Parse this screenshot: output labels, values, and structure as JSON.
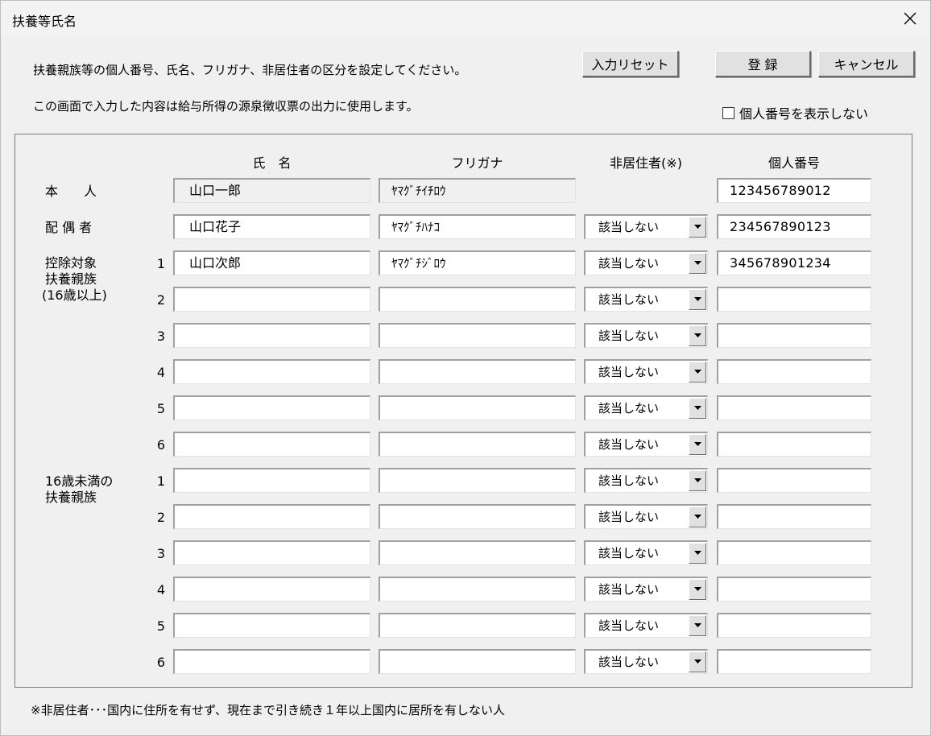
{
  "window": {
    "title": "扶養等氏名",
    "close_glyph": "✕"
  },
  "description": {
    "line1": "扶養親族等の個人番号、氏名、フリガナ、非居住者の区分を設定してください。",
    "line2": "この画面で入力した内容は給与所得の源泉徴収票の出力に使用します。"
  },
  "buttons": {
    "reset": "入力リセット",
    "register": "登 録",
    "cancel": "キャンセル"
  },
  "hide_id_checkbox": {
    "label": "個人番号を表示しない",
    "checked": false
  },
  "headers": {
    "name": "氏　名",
    "furigana": "フリガナ",
    "nonresident": "非居住者(※)",
    "id_number": "個人番号"
  },
  "rows": {
    "self": {
      "label": "本　　人",
      "name": "山口一郎",
      "furigana": "ﾔﾏｸﾞﾁｲﾁﾛｳ",
      "id_number": "123456789012"
    },
    "spouse": {
      "label": "配 偶 者",
      "name": "山口花子",
      "furigana": "ﾔﾏｸﾞﾁﾊﾅｺ",
      "nonresident": "該当しない",
      "id_number": "234567890123"
    }
  },
  "groups": {
    "over16": {
      "label_lines": [
        "控除対象",
        "扶養親族",
        "(16歳以上)"
      ],
      "rows": [
        {
          "no": "1",
          "name": "山口次郎",
          "furigana": "ﾔﾏｸﾞﾁｼﾞﾛｳ",
          "nonresident": "該当しない",
          "id_number": "345678901234"
        },
        {
          "no": "2",
          "name": "",
          "furigana": "",
          "nonresident": "該当しない",
          "id_number": ""
        },
        {
          "no": "3",
          "name": "",
          "furigana": "",
          "nonresident": "該当しない",
          "id_number": ""
        },
        {
          "no": "4",
          "name": "",
          "furigana": "",
          "nonresident": "該当しない",
          "id_number": ""
        },
        {
          "no": "5",
          "name": "",
          "furigana": "",
          "nonresident": "該当しない",
          "id_number": ""
        },
        {
          "no": "6",
          "name": "",
          "furigana": "",
          "nonresident": "該当しない",
          "id_number": ""
        }
      ]
    },
    "under16": {
      "label_lines": [
        "16歳未満の",
        "扶養親族"
      ],
      "rows": [
        {
          "no": "1",
          "name": "",
          "furigana": "",
          "nonresident": "該当しない",
          "id_number": ""
        },
        {
          "no": "2",
          "name": "",
          "furigana": "",
          "nonresident": "該当しない",
          "id_number": ""
        },
        {
          "no": "3",
          "name": "",
          "furigana": "",
          "nonresident": "該当しない",
          "id_number": ""
        },
        {
          "no": "4",
          "name": "",
          "furigana": "",
          "nonresident": "該当しない",
          "id_number": ""
        },
        {
          "no": "5",
          "name": "",
          "furigana": "",
          "nonresident": "該当しない",
          "id_number": ""
        },
        {
          "no": "6",
          "name": "",
          "furigana": "",
          "nonresident": "該当しない",
          "id_number": ""
        }
      ]
    }
  },
  "footnote": "※非居住者･･･国内に住所を有せず、現在まで引き続き１年以上国内に居所を有しない人"
}
